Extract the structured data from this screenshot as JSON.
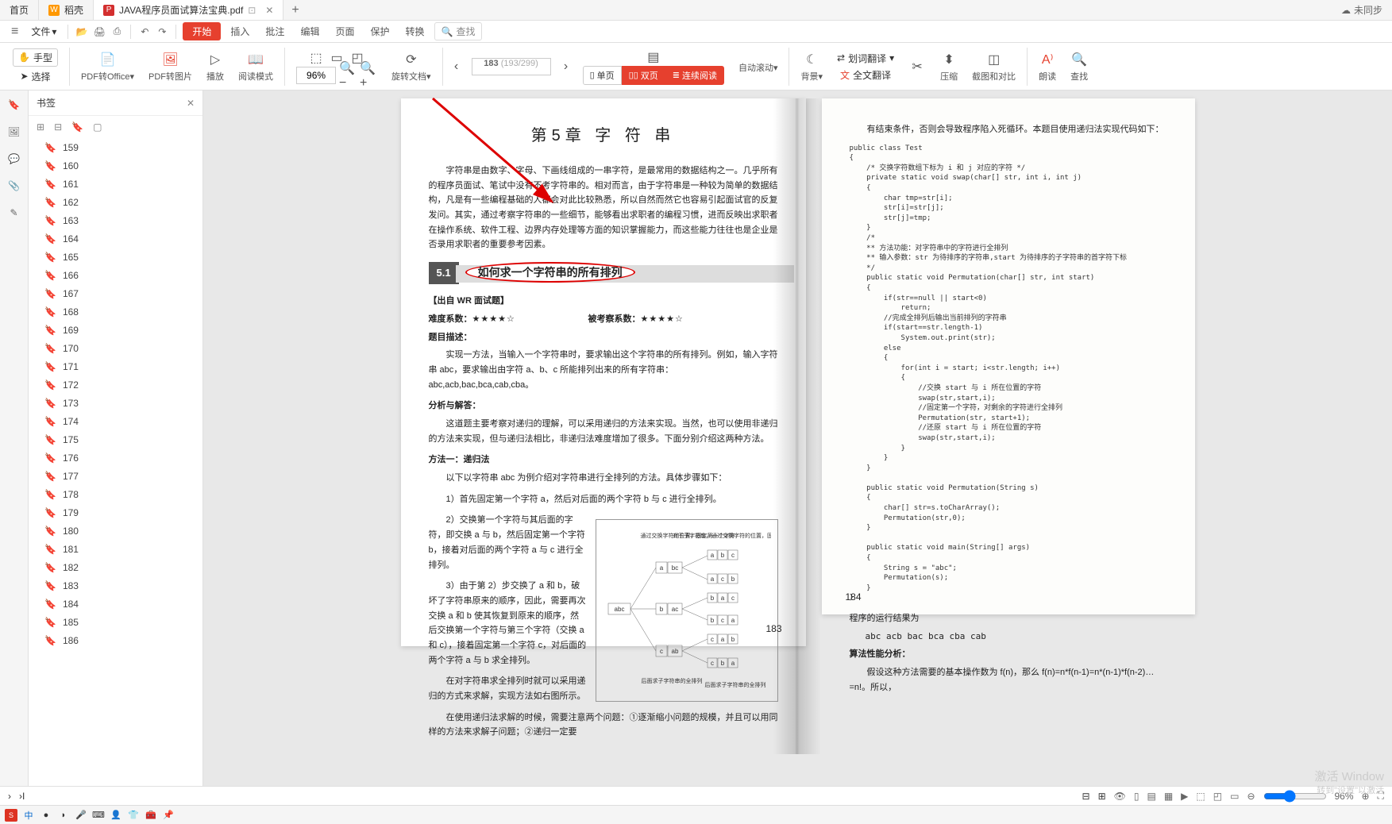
{
  "tabs": {
    "home": "首页",
    "shell": "稻壳",
    "file": "JAVA程序员面试算法宝典.pdf"
  },
  "sync": "未同步",
  "file_menu": "文件",
  "menu": {
    "start": "开始",
    "insert": "插入",
    "review": "批注",
    "edit": "编辑",
    "page": "页面",
    "protect": "保护",
    "convert": "转换",
    "search": "查找"
  },
  "ribbon": {
    "hand": "手型",
    "select": "选择",
    "pdf_office": "PDF转Office",
    "pdf_pic": "PDF转图片",
    "play": "播放",
    "read_mode": "阅读模式",
    "zoom": "96%",
    "rotate": "旋转文档",
    "page_current": "183",
    "page_total": "(193/299)",
    "single": "单页",
    "double": "双页",
    "continuous": "连续阅读",
    "auto_scroll": "自动滚动",
    "bg": "背景",
    "word_trans": "划词翻译",
    "full_trans": "全文翻译",
    "compress": "压缩",
    "crop_compare": "截图和对比",
    "read_aloud": "朗读",
    "find": "查找"
  },
  "bookmark": {
    "title": "书签",
    "items": [
      "159",
      "160",
      "161",
      "162",
      "163",
      "164",
      "165",
      "166",
      "167",
      "168",
      "169",
      "170",
      "171",
      "172",
      "173",
      "174",
      "175",
      "176",
      "177",
      "178",
      "179",
      "180",
      "181",
      "182",
      "183",
      "184",
      "185",
      "186"
    ]
  },
  "doc": {
    "chapter": "第5章 字 符 串",
    "intro1": "字符串是由数字、字母、下画线组成的一串字符，是最常用的数据结构之一。几乎所有的程序员面试、笔试中没有不考字符串的。相对而言，由于字符串是一种较为简单的数据结构，凡是有一些编程基础的人都会对此比较熟悉，所以自然而然它也容易引起面试官的反复发问。其实，通过考察字符串的一些细节，能够看出求职者的编程习惯，进而反映出求职者在操作系统、软件工程、边界内存处理等方面的知识掌握能力，而这些能力往往也是企业是否录用求职者的重要参考因素。",
    "sec_num": "5.1",
    "sec_title": "如何求一个字符串的所有排列",
    "wr": "【出自 WR 面试题】",
    "difficulty_label": "难度系数：",
    "difficulty_stars": "★★★★☆",
    "exam_label": "被考察系数：",
    "exam_stars": "★★★★☆",
    "desc_label": "题目描述：",
    "desc": "实现一方法，当输入一个字符串时，要求输出这个字符串的所有排列。例如，输入字符串 abc，要求输出由字符 a、b、c 所能排列出来的所有字符串：abc,acb,bac,bca,cab,cba。",
    "analysis_label": "分析与解答：",
    "analysis": "这道题主要考察对递归的理解，可以采用递归的方法来实现。当然，也可以使用非递归的方法来实现，但与递归法相比，非递归法难度增加了很多。下面分别介绍这两种方法。",
    "method1_label": "方法一：递归法",
    "method1_1": "以下以字符串 abc 为例介绍对字符串进行全排列的方法。具体步骤如下：",
    "method1_2": "1）首先固定第一个字符 a，然后对后面的两个字符 b 与 c 进行全排列。",
    "method1_3": "2）交换第一个字符与其后面的字符，即交换 a 与 b，然后固定第一个字符 b，接着对后面的两个字符 a 与 c 进行全排列。",
    "method1_4": "3）由于第 2）步交换了 a 和 b，破坏了字符串原来的顺序，因此，需要再次交换 a 和 b 使其恢复到原来的顺序，然后交换第一个字符与第三个字符（交换 a 和 c），接着固定第一个字符 c，对后面的两个字符 a 与 b 求全排列。",
    "method1_5": "在对字符串求全排列时就可以采用递归的方式来求解，实现方法如右图所示。",
    "method1_6": "在使用递归法求解的时候，需要注意两个问题：①逐渐缩小问题的规模，并且可以用同样的方法来求解子问题；②递归一定要",
    "page_left_num": "183",
    "right_intro": "有结束条件，否则会导致程序陷入死循环。本题目使用递归法实现代码如下：",
    "code": "public class Test\n{\n    /* 交换字符数组下标为 i 和 j 对应的字符 */\n    private static void swap(char[] str, int i, int j)\n    {\n        char tmp=str[i];\n        str[i]=str[j];\n        str[j]=tmp;\n    }\n    /*\n    ** 方法功能：对字符串中的字符进行全排列\n    ** 输入参数：str 为待排序的字符串,start 为待排序的子字符串的首字符下标\n    */\n    public static void Permutation(char[] str, int start)\n    {\n        if(str==null || start<0)\n            return;\n        //完成全排列后输出当前排列的字符串\n        if(start==str.length-1)\n            System.out.print(str);\n        else\n        {\n            for(int i = start; i<str.length; i++)\n            {\n                //交换 start 与 i 所在位置的字符\n                swap(str,start,i);\n                //固定第一个字符，对剩余的字符进行全排列\n                Permutation(str, start+1);\n                //还原 start 与 i 所在位置的字符\n                swap(str,start,i);\n            }\n        }\n    }\n\n    public static void Permutation(String s)\n    {\n        char[] str=s.toCharArray();\n        Permutation(str,0);\n    }\n\n    public static void main(String[] args)\n    {\n        String s = \"abc\";\n        Permutation(s);\n    }\n}",
    "result_label": "程序的运行结果为",
    "result": "abc   acb   bac   bca   cba   cab",
    "perf_label": "算法性能分析：",
    "perf": "假设这种方法需要的基本操作数为 f(n)，那么 f(n)=n*f(n-1)=n*(n-1)*f(n-2)…=n!。所以，",
    "page_right_num": "184"
  },
  "status": {
    "zoom": "96%"
  },
  "watermark": {
    "l1": "激活 Window",
    "l2": "转到\"设置\"以激活"
  }
}
